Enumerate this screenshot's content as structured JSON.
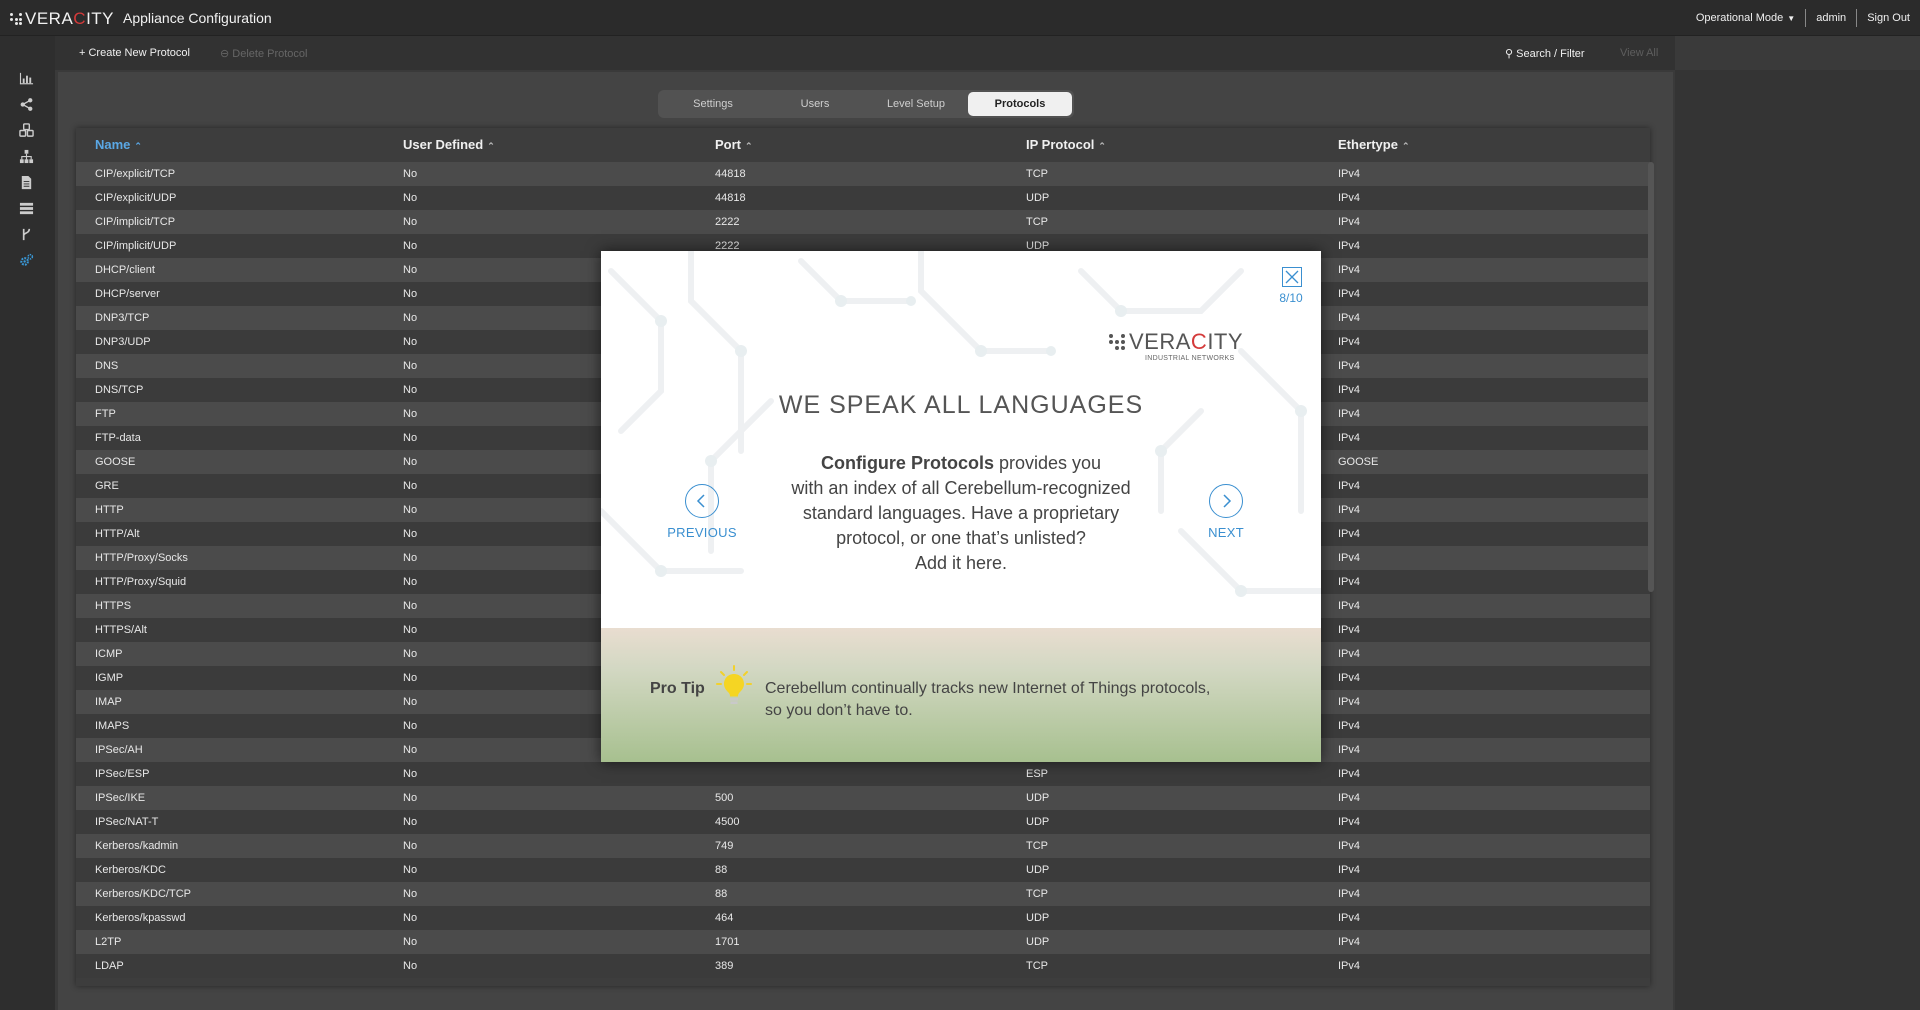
{
  "app": {
    "brand_prefix": "VERA",
    "brand_red": "C",
    "brand_suffix": "ITY",
    "title": "Appliance Configuration"
  },
  "topbar": {
    "mode": "Operational Mode",
    "user": "admin",
    "signout": "Sign Out"
  },
  "sidebar": {
    "icons": [
      "bar-chart-icon",
      "share-icon",
      "cubes-icon",
      "sitemap-icon",
      "document-icon",
      "server-icon",
      "branch-icon",
      "settings-gears-icon"
    ]
  },
  "toolbar": {
    "create": "+ Create New Protocol",
    "delete": "⊖ Delete Protocol",
    "search": "Search / Filter",
    "view_all": "View All"
  },
  "tabs": [
    {
      "label": "Settings",
      "active": false
    },
    {
      "label": "Users",
      "active": false
    },
    {
      "label": "Level Setup",
      "active": false
    },
    {
      "label": "Protocols",
      "active": true
    }
  ],
  "table": {
    "columns": [
      {
        "label": "Name",
        "sorted": true
      },
      {
        "label": "User Defined",
        "sorted": false
      },
      {
        "label": "Port",
        "sorted": false
      },
      {
        "label": "IP Protocol",
        "sorted": false
      },
      {
        "label": "Ethertype",
        "sorted": false
      }
    ],
    "rows": [
      [
        "CIP/explicit/TCP",
        "No",
        "44818",
        "TCP",
        "IPv4"
      ],
      [
        "CIP/explicit/UDP",
        "No",
        "44818",
        "UDP",
        "IPv4"
      ],
      [
        "CIP/implicit/TCP",
        "No",
        "2222",
        "TCP",
        "IPv4"
      ],
      [
        "CIP/implicit/UDP",
        "No",
        "2222",
        "UDP",
        "IPv4"
      ],
      [
        "DHCP/client",
        "No",
        "",
        "",
        "IPv4"
      ],
      [
        "DHCP/server",
        "No",
        "",
        "",
        "IPv4"
      ],
      [
        "DNP3/TCP",
        "No",
        "",
        "",
        "IPv4"
      ],
      [
        "DNP3/UDP",
        "No",
        "",
        "",
        "IPv4"
      ],
      [
        "DNS",
        "No",
        "",
        "",
        "IPv4"
      ],
      [
        "DNS/TCP",
        "No",
        "",
        "",
        "IPv4"
      ],
      [
        "FTP",
        "No",
        "",
        "",
        "IPv4"
      ],
      [
        "FTP-data",
        "No",
        "",
        "",
        "IPv4"
      ],
      [
        "GOOSE",
        "No",
        "",
        "",
        "GOOSE"
      ],
      [
        "GRE",
        "No",
        "",
        "",
        "IPv4"
      ],
      [
        "HTTP",
        "No",
        "",
        "",
        "IPv4"
      ],
      [
        "HTTP/Alt",
        "No",
        "",
        "",
        "IPv4"
      ],
      [
        "HTTP/Proxy/Socks",
        "No",
        "",
        "",
        "IPv4"
      ],
      [
        "HTTP/Proxy/Squid",
        "No",
        "",
        "",
        "IPv4"
      ],
      [
        "HTTPS",
        "No",
        "",
        "",
        "IPv4"
      ],
      [
        "HTTPS/Alt",
        "No",
        "",
        "",
        "IPv4"
      ],
      [
        "ICMP",
        "No",
        "",
        "",
        "IPv4"
      ],
      [
        "IGMP",
        "No",
        "",
        "",
        "IPv4"
      ],
      [
        "IMAP",
        "No",
        "",
        "",
        "IPv4"
      ],
      [
        "IMAPS",
        "No",
        "",
        "",
        "IPv4"
      ],
      [
        "IPSec/AH",
        "No",
        "",
        "",
        "IPv4"
      ],
      [
        "IPSec/ESP",
        "No",
        "",
        "ESP",
        "IPv4"
      ],
      [
        "IPSec/IKE",
        "No",
        "500",
        "UDP",
        "IPv4"
      ],
      [
        "IPSec/NAT-T",
        "No",
        "4500",
        "UDP",
        "IPv4"
      ],
      [
        "Kerberos/kadmin",
        "No",
        "749",
        "TCP",
        "IPv4"
      ],
      [
        "Kerberos/KDC",
        "No",
        "88",
        "UDP",
        "IPv4"
      ],
      [
        "Kerberos/KDC/TCP",
        "No",
        "88",
        "TCP",
        "IPv4"
      ],
      [
        "Kerberos/kpasswd",
        "No",
        "464",
        "UDP",
        "IPv4"
      ],
      [
        "L2TP",
        "No",
        "1701",
        "UDP",
        "IPv4"
      ],
      [
        "LDAP",
        "No",
        "389",
        "TCP",
        "IPv4"
      ]
    ]
  },
  "modal": {
    "counter": "8/10",
    "logo_prefix": "VERA",
    "logo_red": "C",
    "logo_suffix": "ITY",
    "logo_sub": "INDUSTRIAL NETWORKS",
    "title": "WE SPEAK ALL LANGUAGES",
    "body_bold": "Configure Protocols",
    "body_lines": [
      " provides you",
      "with an index of all Cerebellum-recognized",
      "standard languages.  Have a proprietary",
      "protocol, or one that’s unlisted?",
      "Add it here."
    ],
    "prev": "PREVIOUS",
    "next": "NEXT",
    "tip_label": "Pro Tip",
    "tip_lines": [
      "Cerebellum continually tracks new Internet of Things protocols,",
      "so you don’t have to."
    ]
  }
}
